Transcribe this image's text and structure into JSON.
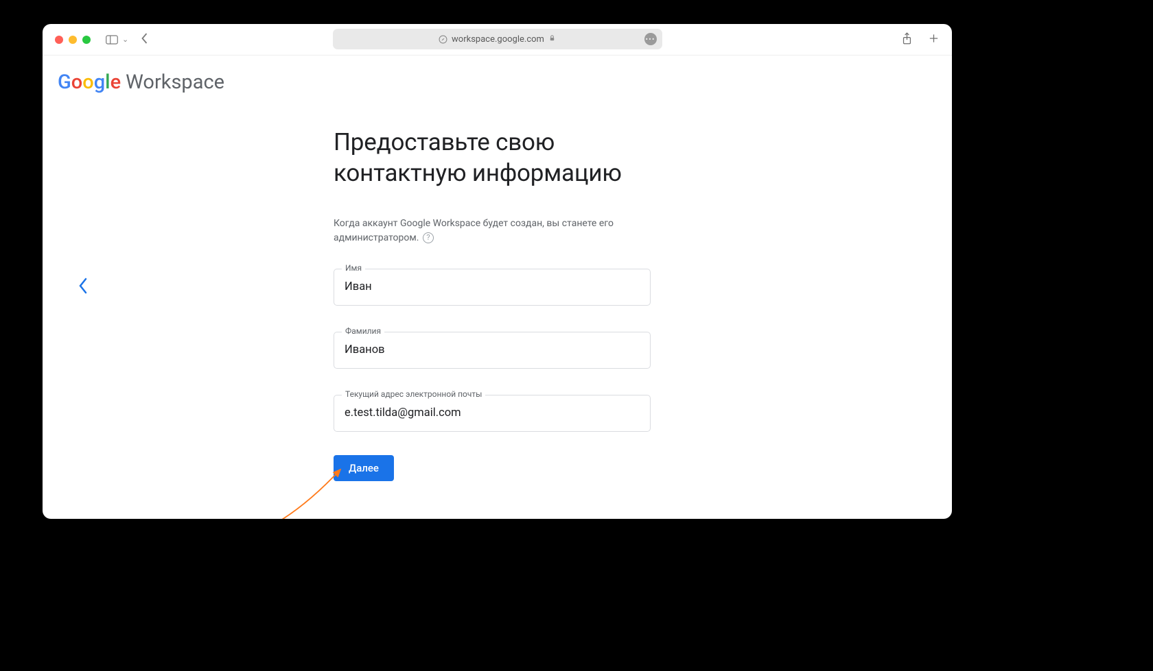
{
  "browser": {
    "url": "workspace.google.com"
  },
  "logo": {
    "google": "Google",
    "workspace": "Workspace"
  },
  "page": {
    "title": "Предоставьте свою контактную информацию",
    "subtitle": "Когда аккаунт Google Workspace будет создан, вы станете его администратором."
  },
  "form": {
    "firstName": {
      "label": "Имя",
      "value": "Иван"
    },
    "lastName": {
      "label": "Фамилия",
      "value": "Иванов"
    },
    "email": {
      "label": "Текущий адрес электронной почты",
      "value": "e.test.tilda@gmail.com"
    },
    "nextButton": "Далее"
  }
}
